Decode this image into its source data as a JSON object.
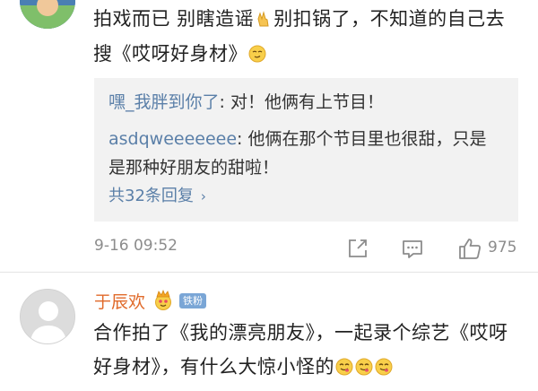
{
  "comment1": {
    "text_a": "拍戏而已 别瞎造谣",
    "text_b": "别扣锅了，不知道的自己去搜《哎呀好身材》",
    "replies": [
      {
        "user": "嘿_我胖到你了",
        "sep": ": ",
        "text": "对！他俩有上节目！"
      },
      {
        "user": "asdqweeeeeee",
        "sep": ": ",
        "text": "他俩在那个节目里也很甜，只是是那种好朋友的甜啦！"
      }
    ],
    "more_replies": "共32条回复",
    "more_chevron": "›",
    "time": "9-16 09:52",
    "like_count": "975"
  },
  "comment2": {
    "user": "于辰欢",
    "badge": "铁粉",
    "text": "合作拍了《我的漂亮朋友》，一起录个综艺《哎呀好身材》，有什么大惊小怪的"
  },
  "colors": {
    "username": "#5a7fa8",
    "orange_name": "#e06a2a",
    "meta": "#8c8c8c",
    "reply_bg": "#f2f2f2"
  },
  "icons": [
    "victory-hand-emoji",
    "smirk-emoji",
    "share-icon",
    "comment-icon",
    "thumbs-up-icon",
    "crown-emoji",
    "yum-emoji"
  ]
}
